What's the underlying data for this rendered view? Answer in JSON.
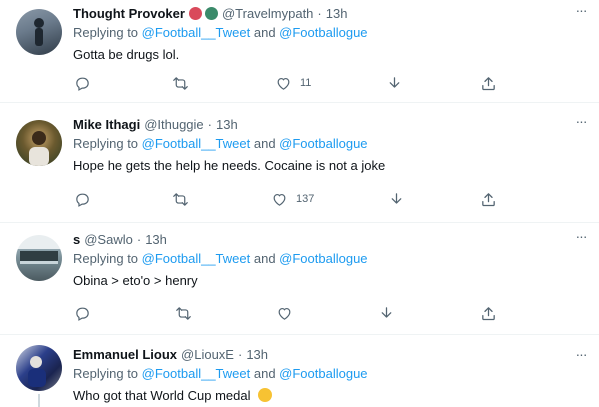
{
  "tweets": [
    {
      "name": "Thought Provoker",
      "handle": "@Travelmypath",
      "dot": "·",
      "time": "13h",
      "replying_prefix": "Replying to ",
      "mention1": "@Football__Tweet",
      "and": " and ",
      "mention2": "@Footballogue",
      "text": "Gotta be drugs lol.",
      "like_count": "11",
      "more": "···",
      "name_emojis": [
        "heart-icon",
        "peacock-icon"
      ],
      "avatar_colors": [
        "#6b7b8c",
        "#2f3b47"
      ]
    },
    {
      "name": "Mike Ithagi",
      "handle": "@Ithuggie",
      "dot": "·",
      "time": "13h",
      "replying_prefix": "Replying to ",
      "mention1": "@Football__Tweet",
      "and": " and ",
      "mention2": "@Footballogue",
      "text": "Hope he gets the help he needs. Cocaine is not a joke",
      "like_count": "137",
      "more": "···",
      "avatar_colors": [
        "#6b5a2f",
        "#2a3a22"
      ]
    },
    {
      "name": "s",
      "handle": "@Sawlo",
      "dot": "·",
      "time": "13h",
      "replying_prefix": "Replying to ",
      "mention1": "@Football__Tweet",
      "and": " and ",
      "mention2": "@Footballogue",
      "text": "Obina > eto'o > henry",
      "like_count": "",
      "more": "···",
      "avatar_colors": [
        "#8fa4ad",
        "#4b5a60"
      ]
    },
    {
      "name": "Emmanuel Lioux",
      "handle": "@LiouxE",
      "dot": "·",
      "time": "13h",
      "replying_prefix": "Replying to ",
      "mention1": "@Football__Tweet",
      "and": " and ",
      "mention2": "@Footballogue",
      "text": "Who got that World Cup medal",
      "text_emoji": "thinking-face-icon",
      "more": "···",
      "avatar_colors": [
        "#2b3f8a",
        "#7a7f8c"
      ]
    }
  ],
  "colors": {
    "accent": "#1d9bf0",
    "secondary_text": "#536471",
    "divider": "#eff3f4"
  }
}
